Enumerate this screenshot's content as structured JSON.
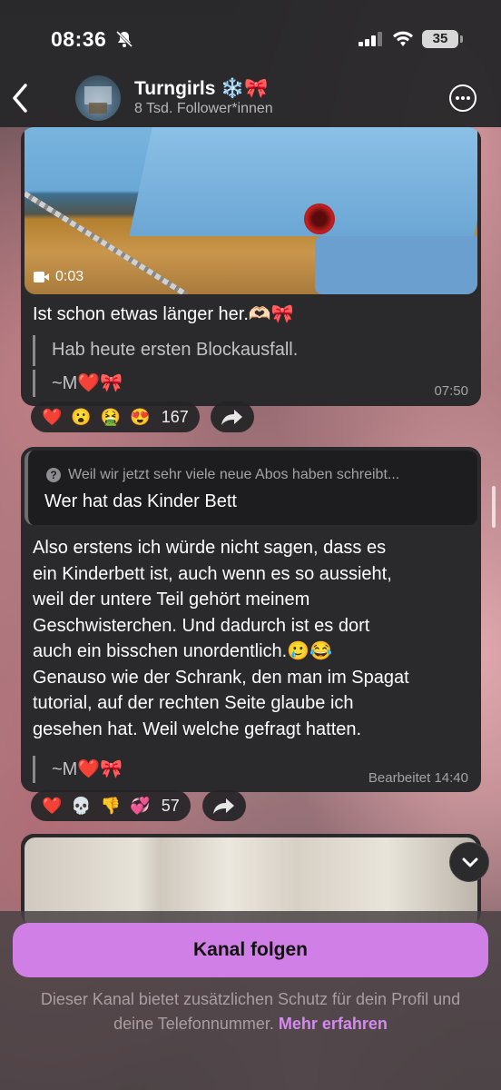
{
  "status_bar": {
    "time": "08:36",
    "battery": "35"
  },
  "header": {
    "channel_name": "Turngirls ❄️🎀",
    "followers": "8 Tsd. Follower*innen"
  },
  "messages": [
    {
      "video_duration": "0:03",
      "text": "Ist schon etwas länger her.🫶🏻🎀",
      "quote": "Hab heute ersten Blockausfall.",
      "signature": "~M❤️🎀",
      "time": "07:50",
      "reactions": [
        "❤️",
        "😮",
        "🤮",
        "😍"
      ],
      "reaction_count": "167"
    },
    {
      "reply_header": "Weil wir jetzt sehr viele neue Abos haben schreibt...",
      "reply_text": "Wer hat das Kinder Bett",
      "text_lines": [
        "Also erstens ich würde nicht sagen, dass es",
        "ein Kinderbett ist, auch wenn es so aussieht,",
        "weil der untere Teil gehört meinem",
        "Geschwisterchen. Und dadurch ist es dort",
        "auch ein bisschen unordentlich.🥲😂",
        "Genauso wie der Schrank, den man im Spagat",
        "tutorial, auf der rechten Seite glaube ich",
        "gesehen hat. Weil welche gefragt hatten."
      ],
      "signature": "~M❤️🎀",
      "time": "Bearbeitet  14:40",
      "reactions": [
        "❤️",
        "💀",
        "👎",
        "💞"
      ],
      "reaction_count": "57"
    }
  ],
  "footer": {
    "follow_button": "Kanal folgen",
    "info_text": "Dieser Kanal bietet zusätzlichen Schutz für dein Profil und deine Telefonnummer.",
    "info_link": "Mehr erfahren"
  }
}
